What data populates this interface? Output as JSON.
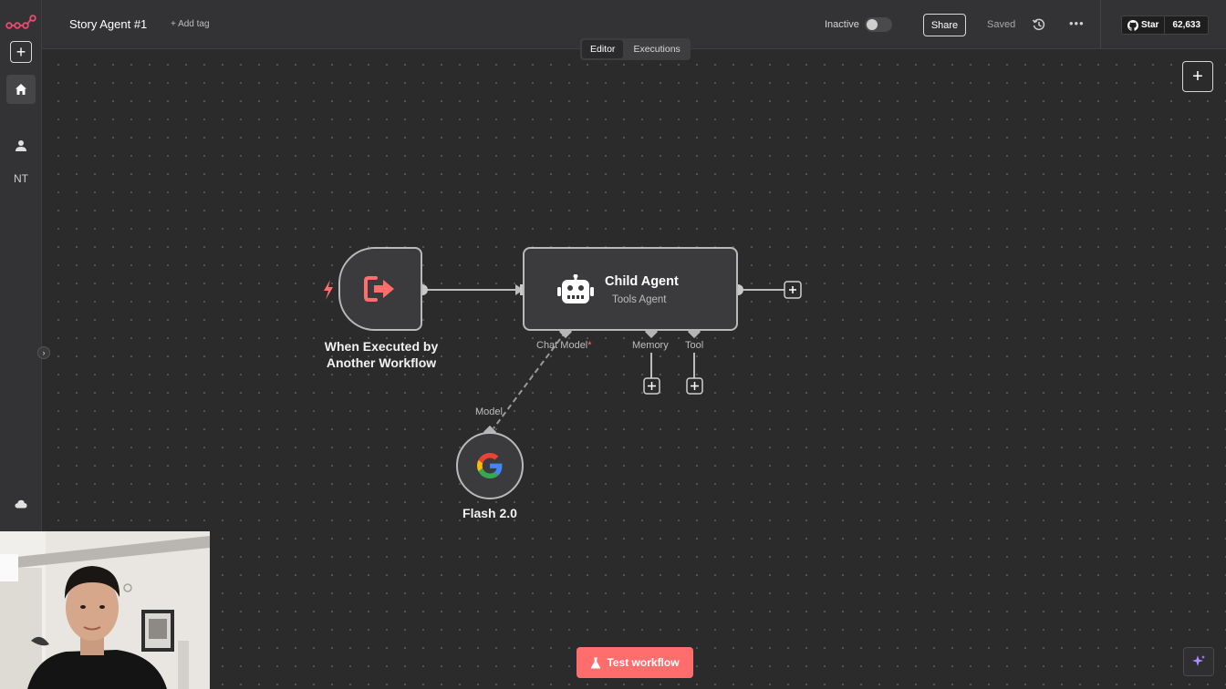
{
  "header": {
    "workflow_title": "Story Agent #1",
    "add_tag": "+ Add tag",
    "status_label": "Inactive",
    "share_label": "Share",
    "saved_label": "Saved",
    "github_star_label": "Star",
    "github_star_count": "62,633"
  },
  "tabs": [
    {
      "label": "Editor",
      "active": true
    },
    {
      "label": "Executions",
      "active": false
    }
  ],
  "sidebar": {
    "user_initials": "NT",
    "icons": [
      "n8n-logo-icon",
      "plus-icon",
      "home-icon",
      "user-icon",
      "cloud-icon",
      "chevron-right-icon"
    ]
  },
  "nodes": {
    "trigger": {
      "label_line1": "When Executed by",
      "label_line2": "Another Workflow",
      "icon": "sign-out-arrow-icon"
    },
    "agent": {
      "title": "Child Agent",
      "subtitle": "Tools Agent",
      "icon": "robot-icon",
      "ports": {
        "chat_model": "Chat Model",
        "chat_model_required": "*",
        "memory": "Memory",
        "tool": "Tool"
      }
    },
    "model": {
      "label": "Flash 2.0",
      "port_label": "Model",
      "icon": "google-g-icon"
    }
  },
  "footer": {
    "test_label": "Test workflow"
  },
  "colors": {
    "accent": "#ff6d6d",
    "canvas_bg": "#2b2b2b",
    "node_border": "#b9b9b9"
  }
}
